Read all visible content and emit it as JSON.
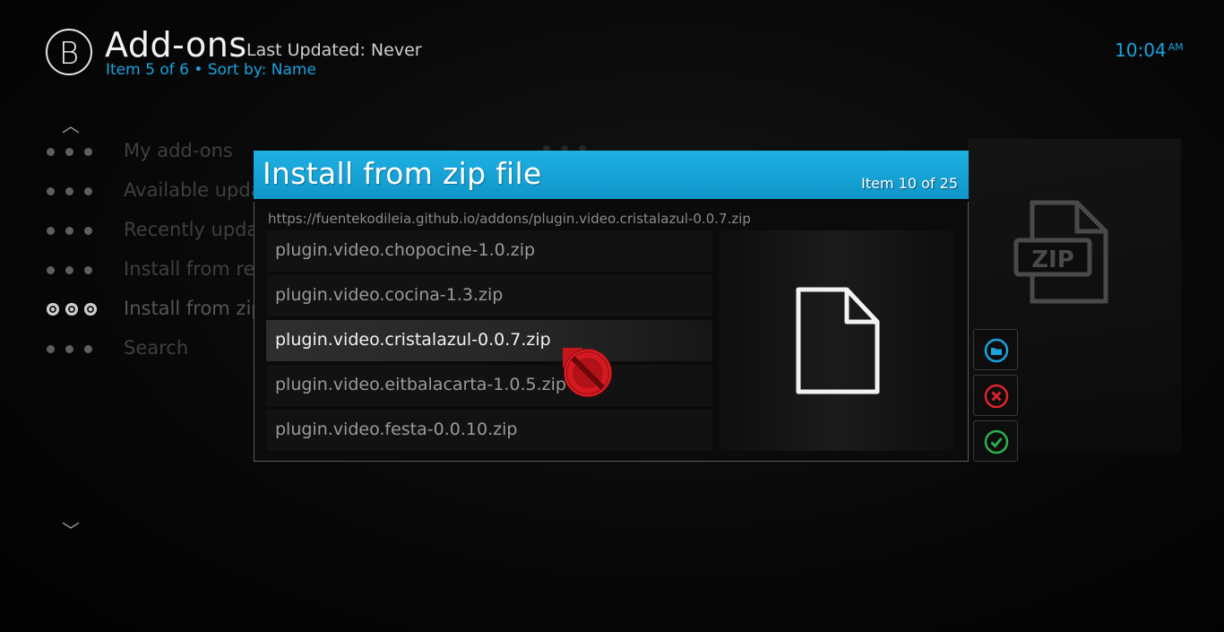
{
  "header": {
    "logo_letter": "B",
    "title": "Add-ons",
    "last_updated": "Last Updated: Never",
    "subline": "Item 5 of 6 • Sort by: Name",
    "clock_time": "10:04",
    "clock_ampm": "AM"
  },
  "menu": {
    "items": [
      {
        "label": "My add-ons"
      },
      {
        "label": "Available updates"
      },
      {
        "label": "Recently updated"
      },
      {
        "label": "Install from repository"
      },
      {
        "label": "Install from zip file"
      },
      {
        "label": "Search"
      }
    ],
    "active_index": 4
  },
  "dialog": {
    "title": "Install from zip file",
    "count": "Item 10 of 25",
    "path": "https://fuentekodileia.github.io/addons/plugin.video.cristalazul-0.0.7.zip",
    "files": [
      {
        "name": "plugin.video.chopocine-1.0.zip"
      },
      {
        "name": "plugin.video.cocina-1.3.zip"
      },
      {
        "name": "plugin.video.cristalazul-0.0.7.zip",
        "selected": true
      },
      {
        "name": "plugin.video.eitbalacarta-1.0.5.zip"
      },
      {
        "name": "plugin.video.festa-0.0.10.zip"
      }
    ]
  },
  "side_buttons": [
    {
      "icon": "folder-icon",
      "color": "#1aa3df"
    },
    {
      "icon": "cancel-icon",
      "color": "#e0242a"
    },
    {
      "icon": "confirm-icon",
      "color": "#2bb24c"
    }
  ],
  "bg_icon_label": "ZIP",
  "colors": {
    "accent": "#1aa3df",
    "header_bg": "#1fb1e4"
  }
}
